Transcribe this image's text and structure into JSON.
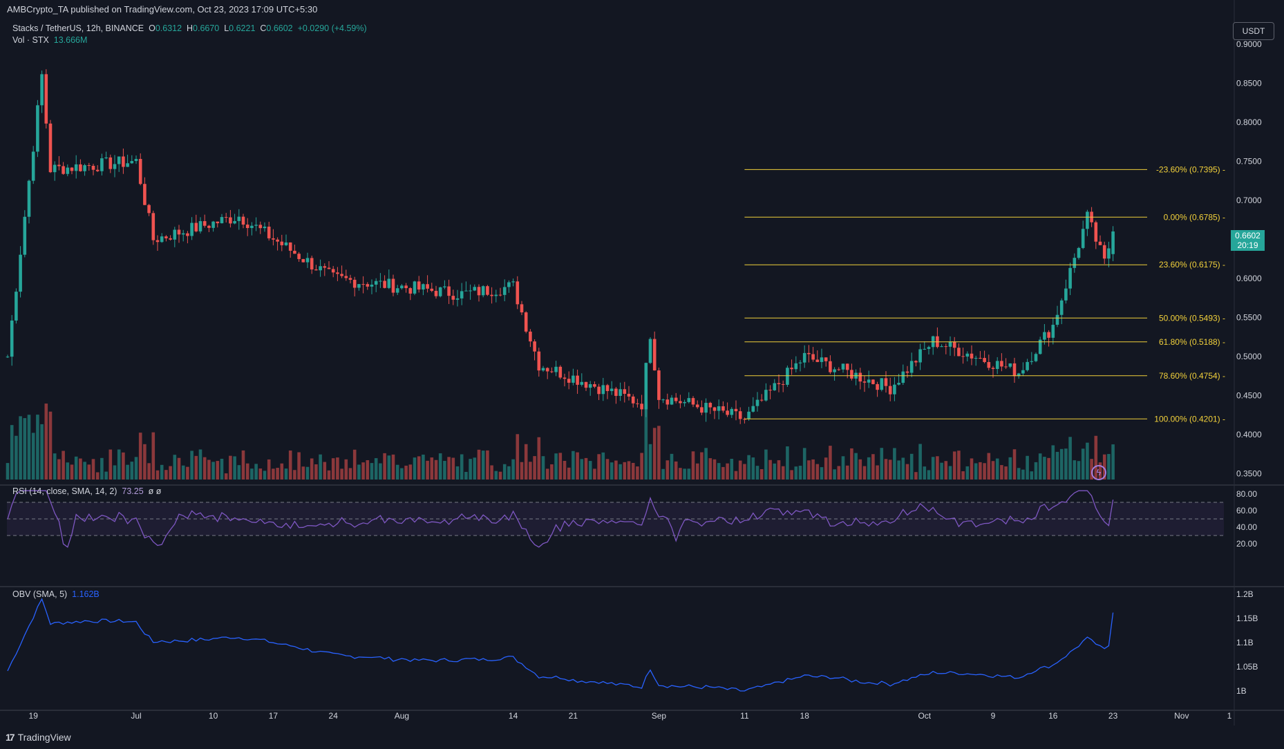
{
  "header": {
    "publisher": "AMBCrypto_TA published on TradingView.com, Oct 23, 2023 17:09 UTC+5:30"
  },
  "legend": {
    "symbol": "Stacks / TetherUS, 12h, BINANCE",
    "o_label": "O",
    "o_value": "0.6312",
    "h_label": "H",
    "h_value": "0.6670",
    "l_label": "L",
    "l_value": "0.6221",
    "c_label": "C",
    "c_value": "0.6602",
    "change": "+0.0290 (+4.59%)",
    "vol_label": "Vol · STX",
    "vol_value": "13.666M"
  },
  "currency_button": "USDT",
  "last_price": {
    "value": "0.6602",
    "countdown": "20:19"
  },
  "rsi": {
    "label": "RSI (14, close, SMA, 14, 2)",
    "value": "73.25",
    "extra": "ø ø"
  },
  "obv": {
    "label": "OBV (SMA, 5)",
    "value": "1.162B"
  },
  "branding": "TradingView",
  "colors": {
    "background": "#131722",
    "up": "#26a69a",
    "down": "#ef5350",
    "fib": "#f2d13b",
    "rsi_line": "#7e57c2",
    "obv_line": "#2962ff",
    "text": "#d1d4dc"
  },
  "chart_data": [
    {
      "type": "candlestick",
      "title": "Stacks / TetherUS, 12h, BINANCE",
      "y_axis_ticks": [
        "0.9000",
        "0.8500",
        "0.8000",
        "0.7500",
        "0.7000",
        "0.6500",
        "0.6000",
        "0.5500",
        "0.5000",
        "0.4500",
        "0.4000",
        "0.3500"
      ],
      "ylim": [
        0.345,
        0.905
      ],
      "x_axis_ticks": [
        "19",
        "Jul",
        "10",
        "17",
        "24",
        "Aug",
        "14",
        "21",
        "Sep",
        "11",
        "18",
        "Oct",
        "9",
        "16",
        "23",
        "Nov",
        "1"
      ],
      "key_points": [
        {
          "date": "Jun 16",
          "price": 0.5
        },
        {
          "date": "Jun 20",
          "price": 0.86
        },
        {
          "date": "Jun 21",
          "price": 0.74
        },
        {
          "date": "Jul 1",
          "price": 0.75
        },
        {
          "date": "Jul 3",
          "price": 0.65
        },
        {
          "date": "Jul 13",
          "price": 0.68
        },
        {
          "date": "Jul 24",
          "price": 0.6
        },
        {
          "date": "Aug 8",
          "price": 0.58
        },
        {
          "date": "Aug 14",
          "price": 0.59
        },
        {
          "date": "Aug 17",
          "price": 0.49
        },
        {
          "date": "Aug 29",
          "price": 0.44
        },
        {
          "date": "Aug 30",
          "price": 0.53
        },
        {
          "date": "Sep 1",
          "price": 0.45
        },
        {
          "date": "Sep 11",
          "price": 0.42
        },
        {
          "date": "Sep 18",
          "price": 0.5
        },
        {
          "date": "Sep 28",
          "price": 0.46
        },
        {
          "date": "Oct 2",
          "price": 0.52
        },
        {
          "date": "Oct 12",
          "price": 0.48
        },
        {
          "date": "Oct 16",
          "price": 0.54
        },
        {
          "date": "Oct 20",
          "price": 0.6785
        },
        {
          "date": "Oct 22",
          "price": 0.62
        },
        {
          "date": "Oct 23",
          "price": 0.6602
        }
      ],
      "last_candle": {
        "open": 0.6312,
        "high": 0.667,
        "low": 0.6221,
        "close": 0.6602
      },
      "fibonacci": [
        {
          "label": "-23.60% (0.7395)",
          "value": 0.7395
        },
        {
          "label": "0.00% (0.6785)",
          "value": 0.6785
        },
        {
          "label": "23.60% (0.6175)",
          "value": 0.6175
        },
        {
          "label": "50.00% (0.5493)",
          "value": 0.5493
        },
        {
          "label": "61.80% (0.5188)",
          "value": 0.5188
        },
        {
          "label": "78.60% (0.4754)",
          "value": 0.4754
        },
        {
          "label": "100.00% (0.4201)",
          "value": 0.4201
        }
      ]
    },
    {
      "type": "line",
      "title": "RSI (14, close, SMA, 14, 2)",
      "y_axis_ticks": [
        "80.00",
        "60.00",
        "40.00",
        "20.00"
      ],
      "ylim": [
        13,
        86
      ],
      "bands": [
        70,
        50,
        30
      ],
      "current": 73.25
    },
    {
      "type": "line",
      "title": "OBV (SMA, 5)",
      "y_axis_ticks": [
        "1.2B",
        "1.15B",
        "1.1B",
        "1.05B",
        "1B"
      ],
      "ylim": [
        0.99,
        1.205
      ],
      "current": 1.162
    }
  ]
}
